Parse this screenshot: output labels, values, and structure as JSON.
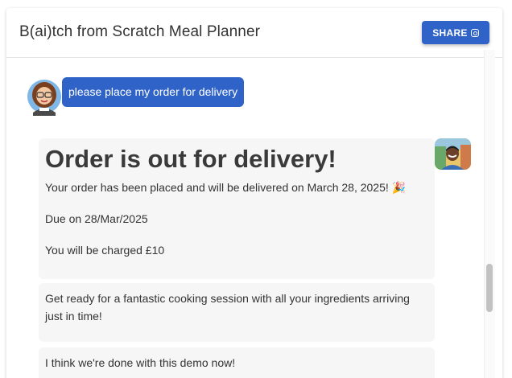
{
  "header": {
    "title": "B(ai)tch from Scratch Meal Planner",
    "share_label": "SHARE",
    "share_icon": "instagram-icon"
  },
  "colors": {
    "accent": "#2f63c8",
    "bot_bubble": "#f6f6f6"
  },
  "chat": {
    "user_message": "please place my order for delivery",
    "user_avatar": "user-avatar-cartoon",
    "bot_avatar": "bot-avatar-photo",
    "bot_messages": [
      {
        "heading": "Order is out for delivery!",
        "lines": [
          "Your order has been placed and will be delivered on March 28, 2025! 🎉",
          "Due on 28/Mar/2025",
          "You will be charged £10"
        ]
      },
      {
        "lines": [
          "Get ready for a fantastic cooking session with all your ingredients arriving just in time!"
        ]
      },
      {
        "lines": [
          "I think we're done with this demo now!"
        ]
      }
    ]
  }
}
